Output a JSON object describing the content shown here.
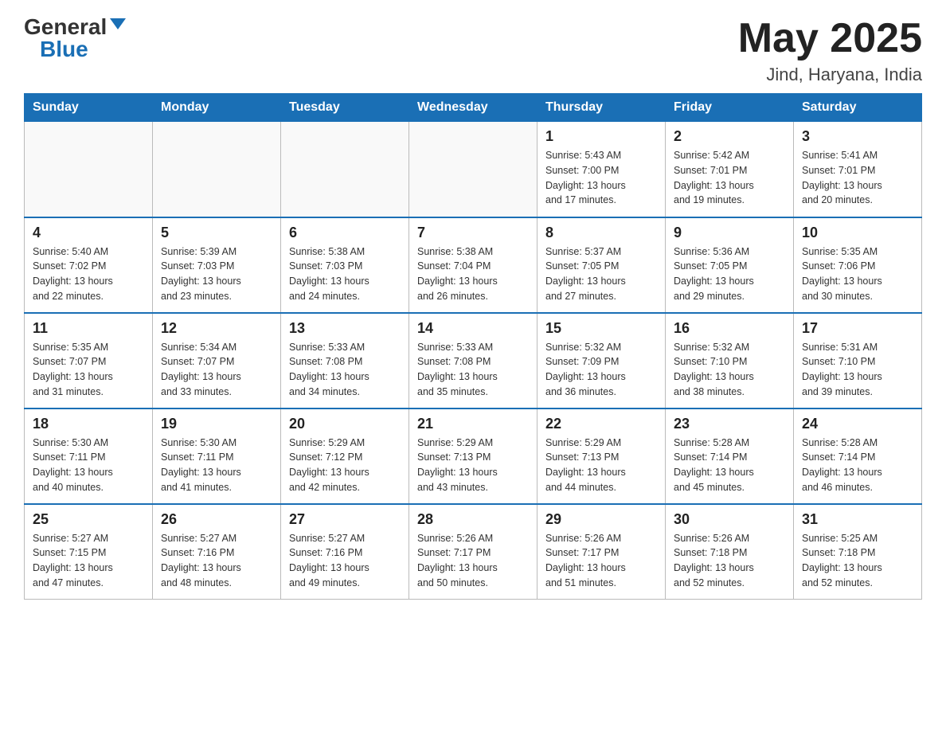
{
  "header": {
    "logo_general": "General",
    "logo_blue": "Blue",
    "month_title": "May 2025",
    "location": "Jind, Haryana, India"
  },
  "days_of_week": [
    "Sunday",
    "Monday",
    "Tuesday",
    "Wednesday",
    "Thursday",
    "Friday",
    "Saturday"
  ],
  "weeks": [
    [
      {
        "day": "",
        "info": ""
      },
      {
        "day": "",
        "info": ""
      },
      {
        "day": "",
        "info": ""
      },
      {
        "day": "",
        "info": ""
      },
      {
        "day": "1",
        "info": "Sunrise: 5:43 AM\nSunset: 7:00 PM\nDaylight: 13 hours\nand 17 minutes."
      },
      {
        "day": "2",
        "info": "Sunrise: 5:42 AM\nSunset: 7:01 PM\nDaylight: 13 hours\nand 19 minutes."
      },
      {
        "day": "3",
        "info": "Sunrise: 5:41 AM\nSunset: 7:01 PM\nDaylight: 13 hours\nand 20 minutes."
      }
    ],
    [
      {
        "day": "4",
        "info": "Sunrise: 5:40 AM\nSunset: 7:02 PM\nDaylight: 13 hours\nand 22 minutes."
      },
      {
        "day": "5",
        "info": "Sunrise: 5:39 AM\nSunset: 7:03 PM\nDaylight: 13 hours\nand 23 minutes."
      },
      {
        "day": "6",
        "info": "Sunrise: 5:38 AM\nSunset: 7:03 PM\nDaylight: 13 hours\nand 24 minutes."
      },
      {
        "day": "7",
        "info": "Sunrise: 5:38 AM\nSunset: 7:04 PM\nDaylight: 13 hours\nand 26 minutes."
      },
      {
        "day": "8",
        "info": "Sunrise: 5:37 AM\nSunset: 7:05 PM\nDaylight: 13 hours\nand 27 minutes."
      },
      {
        "day": "9",
        "info": "Sunrise: 5:36 AM\nSunset: 7:05 PM\nDaylight: 13 hours\nand 29 minutes."
      },
      {
        "day": "10",
        "info": "Sunrise: 5:35 AM\nSunset: 7:06 PM\nDaylight: 13 hours\nand 30 minutes."
      }
    ],
    [
      {
        "day": "11",
        "info": "Sunrise: 5:35 AM\nSunset: 7:07 PM\nDaylight: 13 hours\nand 31 minutes."
      },
      {
        "day": "12",
        "info": "Sunrise: 5:34 AM\nSunset: 7:07 PM\nDaylight: 13 hours\nand 33 minutes."
      },
      {
        "day": "13",
        "info": "Sunrise: 5:33 AM\nSunset: 7:08 PM\nDaylight: 13 hours\nand 34 minutes."
      },
      {
        "day": "14",
        "info": "Sunrise: 5:33 AM\nSunset: 7:08 PM\nDaylight: 13 hours\nand 35 minutes."
      },
      {
        "day": "15",
        "info": "Sunrise: 5:32 AM\nSunset: 7:09 PM\nDaylight: 13 hours\nand 36 minutes."
      },
      {
        "day": "16",
        "info": "Sunrise: 5:32 AM\nSunset: 7:10 PM\nDaylight: 13 hours\nand 38 minutes."
      },
      {
        "day": "17",
        "info": "Sunrise: 5:31 AM\nSunset: 7:10 PM\nDaylight: 13 hours\nand 39 minutes."
      }
    ],
    [
      {
        "day": "18",
        "info": "Sunrise: 5:30 AM\nSunset: 7:11 PM\nDaylight: 13 hours\nand 40 minutes."
      },
      {
        "day": "19",
        "info": "Sunrise: 5:30 AM\nSunset: 7:11 PM\nDaylight: 13 hours\nand 41 minutes."
      },
      {
        "day": "20",
        "info": "Sunrise: 5:29 AM\nSunset: 7:12 PM\nDaylight: 13 hours\nand 42 minutes."
      },
      {
        "day": "21",
        "info": "Sunrise: 5:29 AM\nSunset: 7:13 PM\nDaylight: 13 hours\nand 43 minutes."
      },
      {
        "day": "22",
        "info": "Sunrise: 5:29 AM\nSunset: 7:13 PM\nDaylight: 13 hours\nand 44 minutes."
      },
      {
        "day": "23",
        "info": "Sunrise: 5:28 AM\nSunset: 7:14 PM\nDaylight: 13 hours\nand 45 minutes."
      },
      {
        "day": "24",
        "info": "Sunrise: 5:28 AM\nSunset: 7:14 PM\nDaylight: 13 hours\nand 46 minutes."
      }
    ],
    [
      {
        "day": "25",
        "info": "Sunrise: 5:27 AM\nSunset: 7:15 PM\nDaylight: 13 hours\nand 47 minutes."
      },
      {
        "day": "26",
        "info": "Sunrise: 5:27 AM\nSunset: 7:16 PM\nDaylight: 13 hours\nand 48 minutes."
      },
      {
        "day": "27",
        "info": "Sunrise: 5:27 AM\nSunset: 7:16 PM\nDaylight: 13 hours\nand 49 minutes."
      },
      {
        "day": "28",
        "info": "Sunrise: 5:26 AM\nSunset: 7:17 PM\nDaylight: 13 hours\nand 50 minutes."
      },
      {
        "day": "29",
        "info": "Sunrise: 5:26 AM\nSunset: 7:17 PM\nDaylight: 13 hours\nand 51 minutes."
      },
      {
        "day": "30",
        "info": "Sunrise: 5:26 AM\nSunset: 7:18 PM\nDaylight: 13 hours\nand 52 minutes."
      },
      {
        "day": "31",
        "info": "Sunrise: 5:25 AM\nSunset: 7:18 PM\nDaylight: 13 hours\nand 52 minutes."
      }
    ]
  ]
}
